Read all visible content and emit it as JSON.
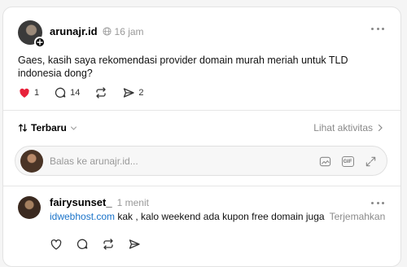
{
  "post": {
    "username": "arunajr.id",
    "time": "16 jam",
    "text": "Gaes, kasih saya rekomendasi provider domain murah meriah untuk TLD indonesia dong?",
    "likes": "1",
    "replies": "14",
    "shares": "2",
    "colors": {
      "like": "#e8213a"
    }
  },
  "sort": {
    "label": "Terbaru",
    "activity_label": "Lihat aktivitas"
  },
  "reply_box": {
    "placeholder": "Balas ke arunajr.id...",
    "gif_label": "GIF"
  },
  "comment": {
    "username": "fairysunset_",
    "time": "1 menit",
    "link_text": "idwebhost.com",
    "text": " kak , kalo weekend ada kupon free domain juga",
    "translate_label": "Terjemahkan"
  }
}
